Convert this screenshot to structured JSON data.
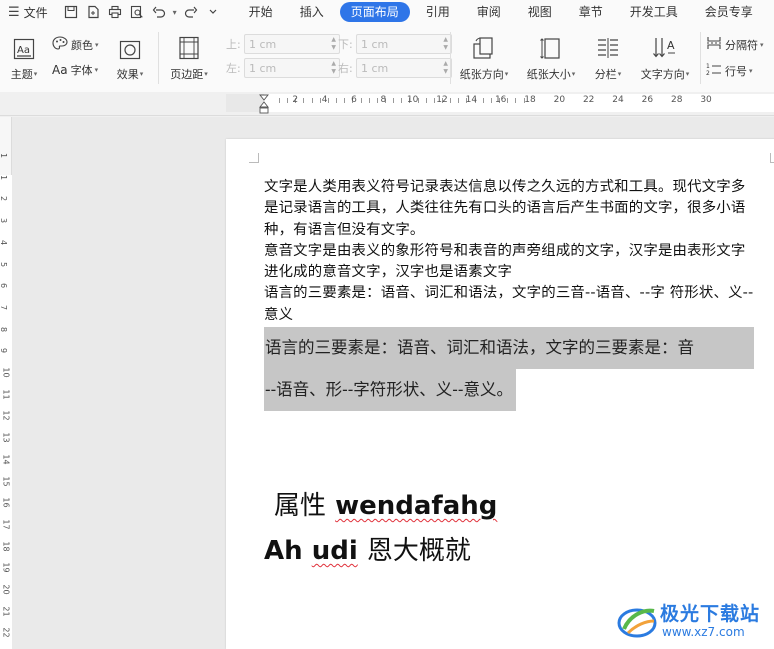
{
  "menubar": {
    "file_label": "文件",
    "tabs": [
      {
        "label": "开始"
      },
      {
        "label": "插入"
      },
      {
        "label": "页面布局"
      },
      {
        "label": "引用"
      },
      {
        "label": "审阅"
      },
      {
        "label": "视图"
      },
      {
        "label": "章节"
      },
      {
        "label": "开发工具"
      },
      {
        "label": "会员专享"
      }
    ],
    "active_tab": "页面布局"
  },
  "ribbon": {
    "theme": "主题",
    "color": "颜色",
    "font": "字体",
    "effect": "效果",
    "margins": "页边距",
    "margin_top_label": "上:",
    "margin_top_value": "1 cm",
    "margin_bottom_label": "下:",
    "margin_bottom_value": "1 cm",
    "margin_left_label": "左:",
    "margin_left_value": "1 cm",
    "margin_right_label": "右:",
    "margin_right_value": "1 cm",
    "orientation": "纸张方向",
    "size": "纸张大小",
    "columns": "分栏",
    "text_direction": "文字方向",
    "breaks": "分隔符",
    "line_numbers": "行号"
  },
  "ruler": {
    "h_labels": [
      "2",
      "4",
      "6",
      "8",
      "10",
      "12",
      "14",
      "16",
      "18",
      "20",
      "22",
      "24",
      "26",
      "28",
      "30"
    ],
    "v_labels": [
      "1",
      "1",
      "2",
      "3",
      "4",
      "5",
      "6",
      "7",
      "8",
      "9",
      "10",
      "11",
      "12",
      "13",
      "14",
      "15",
      "16",
      "17",
      "18",
      "19",
      "20",
      "21",
      "22"
    ]
  },
  "document": {
    "paragraphs": [
      "文字是人类用表义符号记录表达信息以传之久远的方式和工具。现代文字多是记录语言的工具，人类往往先有口头的语言后产生书面的文字，很多小语种，有语言但没有文字。",
      "意音文字是由表义的象形符号和表音的声旁组成的文字，汉字是由表形文字进化成的意音文字，汉字也是语素文字",
      "语言的三要素是：语音、词汇和语法，文字的三音--语音、--字 符形状、义--意义"
    ],
    "selected_line1": "语言的三要素是：语音、词汇和语法，文字的三要素是：音",
    "selected_line2": "--语音、形--字符形状、义--意义。",
    "big_line1_cn": "属性",
    "big_line1_en": "wendafahg",
    "big_line2_en1": "Ah",
    "big_line2_en2": "udi",
    "big_line2_cn": "恩大概就"
  },
  "watermark": {
    "title": "极光下载站",
    "url": "www.xz7.com"
  },
  "colors": {
    "accent": "#2e75e8",
    "selection": "#c6c6c6",
    "spell_error": "#e0303a",
    "watermark": "#2b7be0"
  }
}
